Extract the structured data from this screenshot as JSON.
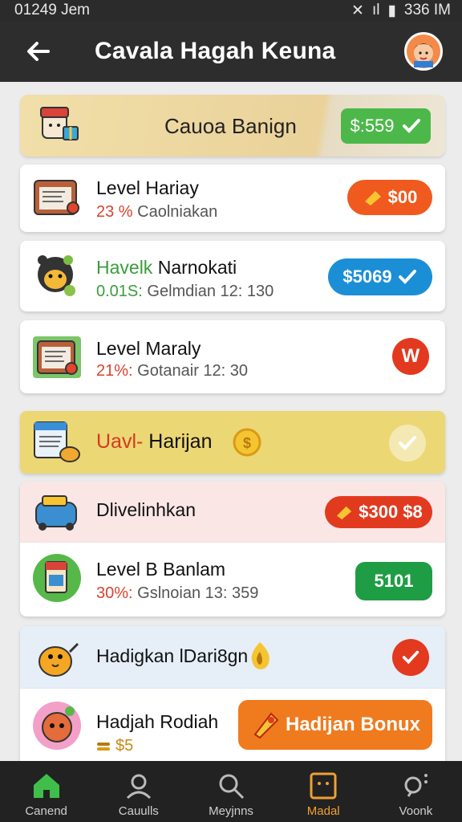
{
  "status_bar": {
    "time_left": "01249 Jem",
    "time_right": "336 IM"
  },
  "app_bar": {
    "title": "Cavala Hagah Keuna",
    "back_icon": "arrow-left-icon"
  },
  "banner": {
    "title": "Cauoa Banign",
    "value": "$:559"
  },
  "rows": [
    {
      "name": "Level Hariay",
      "pct": "23 %",
      "detail": " Caolniakan",
      "action": "$00"
    },
    {
      "name": "Havelk",
      "name_rest": " Narnokati",
      "pct": "0.01S:",
      "detail": " Gelmdian 12: 130",
      "action": "$5069"
    },
    {
      "name": "Level Maraly",
      "pct": "21%:",
      "detail": " Gotanair 12: 30",
      "action": "W"
    },
    {
      "name": "Uavl-",
      "name_rest": " Harijan"
    },
    {
      "name": "Dlivelinhkan",
      "action": "$300 $8"
    },
    {
      "name": "Level B Banlam",
      "pct": "30%:",
      "detail": " Gslnoian 13: 359",
      "action": "5101"
    },
    {
      "name": "Hadigkan lDari8gn"
    },
    {
      "name": "Hadjah Rodiah",
      "sub": "$5",
      "action": "Hadijan Bonux"
    }
  ],
  "nav": [
    {
      "label": "Canend",
      "icon": "home-icon"
    },
    {
      "label": "Cauulls",
      "icon": "user-icon"
    },
    {
      "label": "Meyjnns",
      "icon": "search-icon"
    },
    {
      "label": "Madal",
      "icon": "box-icon"
    },
    {
      "label": "Voonk",
      "icon": "search-sparkle-icon"
    }
  ],
  "colors": {
    "orange": "#f05a1e",
    "green": "#1f9d45",
    "blue": "#1b8fd6",
    "red": "#e2391f",
    "yellow_card": "#ecd775",
    "pink_card": "#fbe6e6",
    "lightblue_card": "#e6eef8"
  }
}
